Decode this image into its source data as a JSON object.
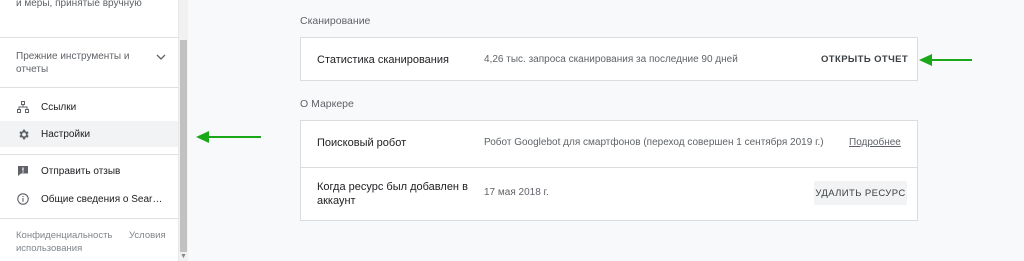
{
  "sidebar": {
    "top_text": "и меры, принятые вручную",
    "legacy_tools": "Прежние инструменты и отчеты",
    "items": [
      {
        "label": "Ссылки",
        "icon": "sitemap-icon"
      },
      {
        "label": "Настройки",
        "icon": "gear-icon"
      },
      {
        "label": "Отправить отзыв",
        "icon": "feedback-icon"
      },
      {
        "label": "Общие сведения о Search ...",
        "icon": "info-icon"
      }
    ],
    "footer": {
      "privacy": "Конфиденциальность",
      "terms": "Условия использования"
    }
  },
  "crawl": {
    "section_title": "Сканирование",
    "label": "Статистика сканирования",
    "value": "4,26 тыс. запроса сканирования за последние 90 дней",
    "button": "ОТКРЫТЬ ОТЧЕТ"
  },
  "about": {
    "section_title": "О Маркере",
    "rows": [
      {
        "label": "Поисковый робот",
        "value": "Робот Googlebot для смартфонов (переход совершен 1 сентября 2019 г.)",
        "link": "Подробнее"
      },
      {
        "label": "Когда ресурс был добавлен в аккаунт",
        "value": "17 мая 2018 г.",
        "button": "УДАЛИТЬ РЕСУРС"
      }
    ]
  },
  "colors": {
    "annotation_arrow": "#1aa81a",
    "card_border": "#dadce0"
  }
}
